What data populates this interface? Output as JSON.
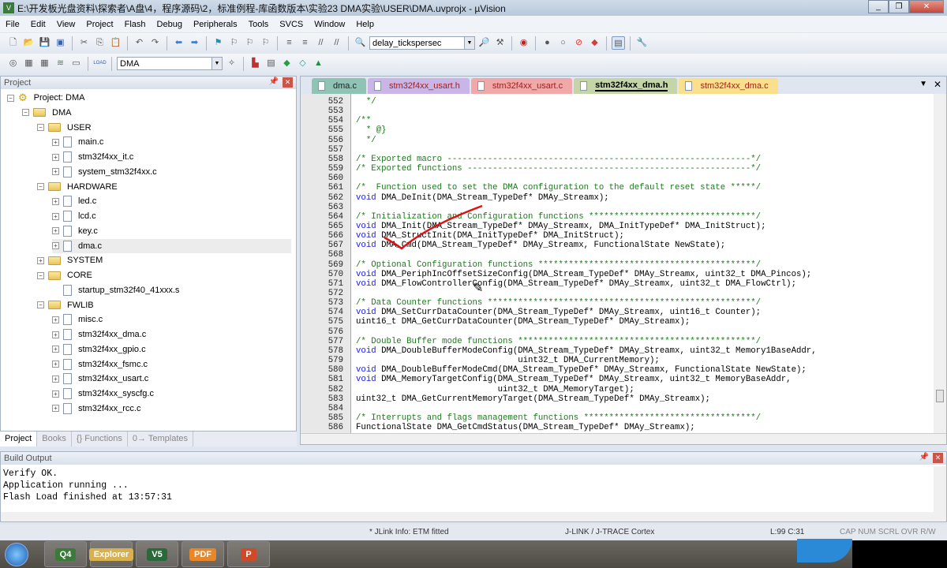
{
  "window": {
    "title": "E:\\开发板光盘资料\\探索者\\A盘\\4，程序源码\\2，标准例程-库函数版本\\实验23 DMA实验\\USER\\DMA.uvprojx - µVision",
    "app_icon": "uvision-icon"
  },
  "menu": [
    "File",
    "Edit",
    "View",
    "Project",
    "Flash",
    "Debug",
    "Peripherals",
    "Tools",
    "SVCS",
    "Window",
    "Help"
  ],
  "toolbar": {
    "find_combo": "delay_tickspersec",
    "target_combo": "DMA",
    "load_label": "LOAD"
  },
  "project": {
    "title": "Project",
    "tree": [
      {
        "label": "Project: DMA",
        "level": 0,
        "type": "root",
        "exp": "−"
      },
      {
        "label": "DMA",
        "level": 1,
        "type": "target",
        "exp": "−"
      },
      {
        "label": "USER",
        "level": 2,
        "type": "folder",
        "exp": "−"
      },
      {
        "label": "main.c",
        "level": 3,
        "type": "file",
        "exp": "+"
      },
      {
        "label": "stm32f4xx_it.c",
        "level": 3,
        "type": "file",
        "exp": "+"
      },
      {
        "label": "system_stm32f4xx.c",
        "level": 3,
        "type": "file",
        "exp": "+"
      },
      {
        "label": "HARDWARE",
        "level": 2,
        "type": "folder",
        "exp": "−"
      },
      {
        "label": "led.c",
        "level": 3,
        "type": "file",
        "exp": "+"
      },
      {
        "label": "lcd.c",
        "level": 3,
        "type": "file",
        "exp": "+"
      },
      {
        "label": "key.c",
        "level": 3,
        "type": "file",
        "exp": "+"
      },
      {
        "label": "dma.c",
        "level": 3,
        "type": "file",
        "exp": "+",
        "selected": true
      },
      {
        "label": "SYSTEM",
        "level": 2,
        "type": "folder",
        "exp": "+"
      },
      {
        "label": "CORE",
        "level": 2,
        "type": "folder",
        "exp": "−"
      },
      {
        "label": "startup_stm32f40_41xxx.s",
        "level": 3,
        "type": "file",
        "exp": ""
      },
      {
        "label": "FWLIB",
        "level": 2,
        "type": "folder",
        "exp": "−"
      },
      {
        "label": "misc.c",
        "level": 3,
        "type": "file",
        "exp": "+"
      },
      {
        "label": "stm32f4xx_dma.c",
        "level": 3,
        "type": "file",
        "exp": "+"
      },
      {
        "label": "stm32f4xx_gpio.c",
        "level": 3,
        "type": "file",
        "exp": "+"
      },
      {
        "label": "stm32f4xx_fsmc.c",
        "level": 3,
        "type": "file",
        "exp": "+"
      },
      {
        "label": "stm32f4xx_usart.c",
        "level": 3,
        "type": "file",
        "exp": "+"
      },
      {
        "label": "stm32f4xx_syscfg.c",
        "level": 3,
        "type": "file",
        "exp": "+"
      },
      {
        "label": "stm32f4xx_rcc.c",
        "level": 3,
        "type": "file",
        "exp": "+"
      }
    ],
    "bottom_tabs": [
      "Project",
      "Books",
      "{} Functions",
      "0→ Templates"
    ]
  },
  "editor": {
    "tabs": [
      {
        "label": "dma.c",
        "color": "#8fc4b4"
      },
      {
        "label": "stm32f4xx_usart.h",
        "color": "#c9b6e6"
      },
      {
        "label": "stm32f4xx_usart.c",
        "color": "#f0a8a8"
      },
      {
        "label": "stm32f4xx_dma.h",
        "color": "#c4d6a8",
        "active": true
      },
      {
        "label": "stm32f4xx_dma.c",
        "color": "#fbe08c"
      }
    ],
    "lines": [
      {
        "n": "552",
        "t": "  */",
        "k": "comment"
      },
      {
        "n": "553",
        "t": "",
        "k": "code"
      },
      {
        "n": "554",
        "t": "/**",
        "k": "comment"
      },
      {
        "n": "555",
        "t": "  * @}",
        "k": "comment"
      },
      {
        "n": "556",
        "t": "  */",
        "k": "comment"
      },
      {
        "n": "557",
        "t": "",
        "k": "code"
      },
      {
        "n": "558",
        "t": "/* Exported macro ------------------------------------------------------------*/",
        "k": "comment"
      },
      {
        "n": "559",
        "t": "/* Exported functions --------------------------------------------------------*/",
        "k": "comment"
      },
      {
        "n": "560",
        "t": "",
        "k": "code"
      },
      {
        "n": "561",
        "t": "/*  Function used to set the DMA configuration to the default reset state *****/",
        "k": "comment"
      },
      {
        "n": "562",
        "t": "void DMA_DeInit(DMA_Stream_TypeDef* DMAy_Streamx);",
        "k": "code"
      },
      {
        "n": "563",
        "t": "",
        "k": "code"
      },
      {
        "n": "564",
        "t": "/* Initialization and Configuration functions *********************************/",
        "k": "comment"
      },
      {
        "n": "565",
        "t": "void DMA_Init(DMA_Stream_TypeDef* DMAy_Streamx, DMA_InitTypeDef* DMA_InitStruct);",
        "k": "code"
      },
      {
        "n": "566",
        "t": "void DMA_StructInit(DMA_InitTypeDef* DMA_InitStruct);",
        "k": "code"
      },
      {
        "n": "567",
        "t": "void DMA_Cmd(DMA_Stream_TypeDef* DMAy_Streamx, FunctionalState NewState);",
        "k": "code"
      },
      {
        "n": "568",
        "t": "",
        "k": "code"
      },
      {
        "n": "569",
        "t": "/* Optional Configuration functions *******************************************/",
        "k": "comment"
      },
      {
        "n": "570",
        "t": "void DMA_PeriphIncOffsetSizeConfig(DMA_Stream_TypeDef* DMAy_Streamx, uint32_t DMA_Pincos);",
        "k": "code"
      },
      {
        "n": "571",
        "t": "void DMA_FlowControllerConfig(DMA_Stream_TypeDef* DMAy_Streamx, uint32_t DMA_FlowCtrl);",
        "k": "code"
      },
      {
        "n": "572",
        "t": "",
        "k": "code"
      },
      {
        "n": "573",
        "t": "/* Data Counter functions *****************************************************/",
        "k": "comment"
      },
      {
        "n": "574",
        "t": "void DMA_SetCurrDataCounter(DMA_Stream_TypeDef* DMAy_Streamx, uint16_t Counter);",
        "k": "code"
      },
      {
        "n": "575",
        "t": "uint16_t DMA_GetCurrDataCounter(DMA_Stream_TypeDef* DMAy_Streamx);",
        "k": "code"
      },
      {
        "n": "576",
        "t": "",
        "k": "code"
      },
      {
        "n": "577",
        "t": "/* Double Buffer mode functions ***********************************************/",
        "k": "comment"
      },
      {
        "n": "578",
        "t": "void DMA_DoubleBufferModeConfig(DMA_Stream_TypeDef* DMAy_Streamx, uint32_t Memory1BaseAddr,",
        "k": "code"
      },
      {
        "n": "579",
        "t": "                                uint32_t DMA_CurrentMemory);",
        "k": "code"
      },
      {
        "n": "580",
        "t": "void DMA_DoubleBufferModeCmd(DMA_Stream_TypeDef* DMAy_Streamx, FunctionalState NewState);",
        "k": "code"
      },
      {
        "n": "581",
        "t": "void DMA_MemoryTargetConfig(DMA_Stream_TypeDef* DMAy_Streamx, uint32_t MemoryBaseAddr,",
        "k": "code"
      },
      {
        "n": "582",
        "t": "                            uint32_t DMA_MemoryTarget);",
        "k": "code"
      },
      {
        "n": "583",
        "t": "uint32_t DMA_GetCurrentMemoryTarget(DMA_Stream_TypeDef* DMAy_Streamx);",
        "k": "code"
      },
      {
        "n": "584",
        "t": "",
        "k": "code"
      },
      {
        "n": "585",
        "t": "/* Interrupts and flags management functions **********************************/",
        "k": "comment"
      },
      {
        "n": "586",
        "t": "FunctionalState DMA_GetCmdStatus(DMA_Stream_TypeDef* DMAy_Streamx);",
        "k": "code"
      }
    ]
  },
  "build": {
    "title": "Build Output",
    "lines": [
      "Verify OK.",
      "Application running ...",
      "Flash Load finished at 13:57:31"
    ]
  },
  "status": {
    "info": "* JLink Info: ETM fitted",
    "debugger": "J-LINK / J-TRACE Cortex",
    "position": "L:99 C:31",
    "flags": "CAP  NUM  SCRL  OVR  R/W"
  },
  "taskbar": {
    "apps": [
      "Q4",
      "Explorer",
      "V5",
      "PDF",
      "P"
    ]
  },
  "colors": {
    "comment": "#1d7a1d",
    "keyword": "#1a1aff",
    "annotation": "#e01010"
  }
}
